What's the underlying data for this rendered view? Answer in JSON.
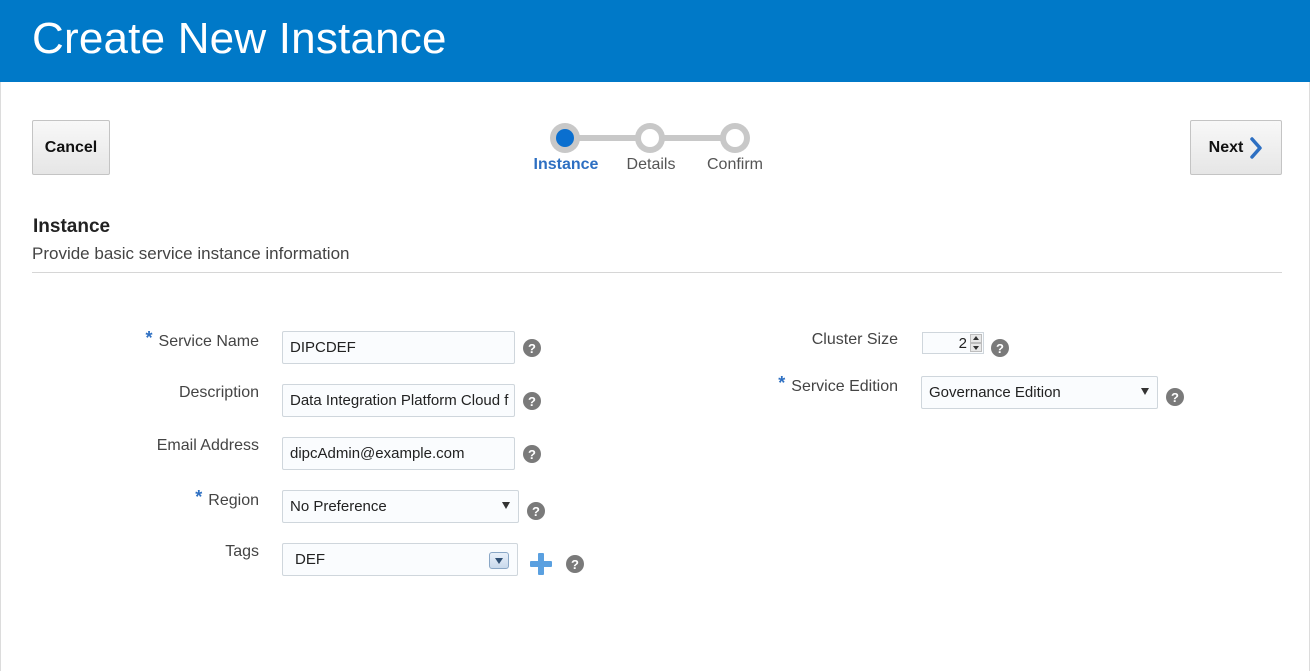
{
  "header": {
    "title": "Create New Instance"
  },
  "toolbar": {
    "cancel_label": "Cancel",
    "next_label": "Next"
  },
  "train": {
    "steps": [
      {
        "label": "Instance",
        "active": true
      },
      {
        "label": "Details",
        "active": false
      },
      {
        "label": "Confirm",
        "active": false
      }
    ]
  },
  "section": {
    "title": "Instance",
    "subtitle": "Provide basic service instance information"
  },
  "form": {
    "service_name": {
      "label": "Service Name",
      "value": "DIPCDEF",
      "required": "*"
    },
    "description": {
      "label": "Description",
      "value": "Data Integration Platform Cloud f"
    },
    "email": {
      "label": "Email Address",
      "value": "dipcAdmin@example.com"
    },
    "region": {
      "label": "Region",
      "value": "No Preference",
      "required": "*"
    },
    "tags": {
      "label": "Tags",
      "value": "DEF"
    },
    "cluster_size": {
      "label": "Cluster Size",
      "value": "2"
    },
    "service_edition": {
      "label": "Service Edition",
      "value": "Governance Edition",
      "required": "*"
    }
  },
  "help_glyph": "?",
  "colors": {
    "header_bg": "#0079c8",
    "accent": "#2d6fc2",
    "train_active": "#0a6fcf",
    "train_inactive": "#c8c8c8"
  }
}
